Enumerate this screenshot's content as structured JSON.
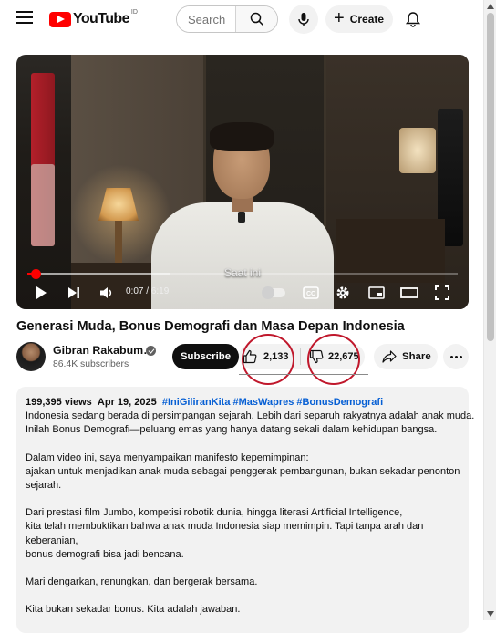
{
  "header": {
    "logo_text": "YouTube",
    "logo_country": "ID",
    "search_placeholder": "Search",
    "create_label": "Create"
  },
  "player": {
    "caption": "Saat ini",
    "time": "0:07 / 6:19",
    "progress_fraction": 0.0185,
    "buffer_fraction": 0.33
  },
  "video": {
    "title": "Generasi Muda, Bonus Demografi dan Masa Depan Indonesia",
    "channel_name": "Gibran Rakabum…",
    "subscribers": "86.4K subscribers",
    "subscribe_label": "Subscribe",
    "likes": "2,133",
    "dislikes": "22,675",
    "share_label": "Share"
  },
  "description": {
    "views": "199,395 views",
    "date": "Apr 19, 2025",
    "tags": "#IniGiliranKita #MasWapres #BonusDemografi",
    "lines": [
      "Indonesia sedang berada di persimpangan sejarah. Lebih dari separuh rakyatnya adalah anak muda.",
      "Inilah Bonus Demografi—peluang emas yang hanya datang sekali dalam kehidupan bangsa.",
      "",
      "Dalam video ini, saya menyampaikan manifesto kepemimpinan:",
      "ajakan untuk menjadikan anak muda sebagai penggerak pembangunan, bukan sekadar penonton",
      "sejarah.",
      "",
      "Dari prestasi film Jumbo, kompetisi robotik dunia, hingga literasi Artificial Intelligence,",
      "kita telah membuktikan bahwa anak muda Indonesia siap memimpin. Tapi tanpa arah dan",
      "keberanian,",
      "bonus demografi bisa jadi bencana.",
      "",
      "Mari dengarkan, renungkan, dan bergerak bersama.",
      "",
      "Kita bukan sekadar bonus. Kita adalah jawaban."
    ]
  },
  "colors": {
    "brand_red": "#ff0000",
    "annotation_red": "#c0182c",
    "link_blue": "#065fd4"
  }
}
